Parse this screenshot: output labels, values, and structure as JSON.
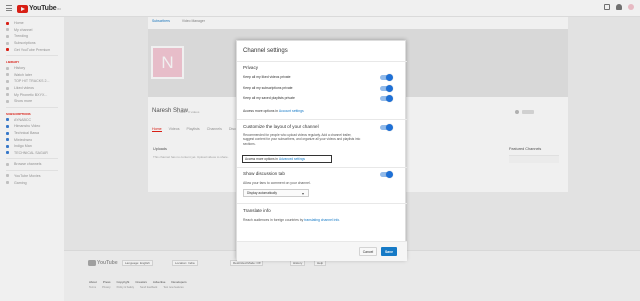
{
  "masthead": {
    "logo_text": "YouTube",
    "country_code": "IN",
    "icons": [
      "hamburger-icon",
      "upload-icon",
      "bell-icon",
      "avatar"
    ]
  },
  "sidebar": {
    "items_top": [
      {
        "label": "Home",
        "icon": "home-icon"
      },
      {
        "label": "My channel",
        "icon": "channel-icon"
      },
      {
        "label": "Trending",
        "icon": "trending-icon"
      },
      {
        "label": "Subscriptions",
        "icon": "subscriptions-icon"
      },
      {
        "label": "Get YouTube Premium",
        "icon": "premium-icon"
      }
    ],
    "library_head": "LIBRARY",
    "items_library": [
      {
        "label": "History",
        "icon": "history-icon"
      },
      {
        "label": "Watch later",
        "icon": "clock-icon"
      },
      {
        "label": "TOP HIT TRACKS 2...",
        "icon": "playlist-icon"
      },
      {
        "label": "Liked videos",
        "icon": "like-icon"
      },
      {
        "label": "My Phonetic BXYX...",
        "icon": "playlist-icon"
      },
      {
        "label": "Show more",
        "icon": "chevron-down-icon"
      }
    ],
    "subs_head": "SUBSCRIPTIONS",
    "items_subs": [
      {
        "label": "AYNABCC",
        "icon": "channel-avatar"
      },
      {
        "label": "Himanshu Video",
        "icon": "channel-avatar"
      },
      {
        "label": "Technical Bawa",
        "icon": "channel-avatar"
      },
      {
        "label": "Mixtechseo",
        "icon": "channel-avatar"
      },
      {
        "label": "Indigo Man",
        "icon": "channel-avatar"
      },
      {
        "label": "TECHNICAL SAGAR",
        "icon": "channel-avatar"
      }
    ],
    "items_bottom": [
      {
        "label": "Browse channels",
        "icon": "plus-icon"
      },
      {
        "label": "YouTube Movies",
        "icon": "movie-icon"
      },
      {
        "label": "Gaming",
        "icon": "gaming-icon"
      }
    ]
  },
  "channel": {
    "top_tabs": [
      "Subscribers",
      "Video Manager"
    ],
    "avatar_letter": "N",
    "name": "Naresh Shaw",
    "views": "1 view · 0 videos",
    "nav": [
      "Home",
      "Videos",
      "Playlists",
      "Channels",
      "Discussion",
      "About"
    ],
    "uploads": "Uploads",
    "uploads_sub": "This channel has no content yet. Upload videos to share.",
    "featured": "Featured Channels"
  },
  "footer": {
    "logo_text": "YouTube",
    "language_btn": "Language: English",
    "location_btn": "Location: India",
    "restricted_btn": "Restricted Mode: Off",
    "history_btn": "History",
    "help_btn": "Help",
    "links": [
      "About",
      "Press",
      "Copyright",
      "Creators",
      "Advertise",
      "Developers"
    ],
    "links2": [
      "Terms",
      "Privacy",
      "Policy & Safety",
      "Send feedback",
      "Test new features"
    ]
  },
  "modal": {
    "title": "Channel settings",
    "privacy": {
      "title": "Privacy",
      "rows": [
        "Keep all my liked videos private",
        "Keep all my subscriptions private",
        "Keep all my saved playlists private"
      ],
      "link_prefix": "Access more options in",
      "link_text": "Account settings"
    },
    "customize": {
      "title": "Customize the layout of your channel",
      "description": "Recommended for people who upload videos regularly. Add a channel trailer, suggest content for your subscribers, and organize all your videos and playlists into sections.",
      "link_prefix": "Access more options in",
      "link_text": "Advanced settings"
    },
    "discussion": {
      "title": "Show discussion tab",
      "description": "Allow your fans to comment on your channel.",
      "select_value": "Display automatically"
    },
    "translate": {
      "title": "Translate info",
      "prefix": "Reach audiences in foreign countries by",
      "link_text": "translating channel info."
    },
    "cancel_label": "Cancel",
    "save_label": "Save"
  },
  "colors": {
    "accent_blue": "#167ac6",
    "toggle_on": "#1e70d6",
    "brand_red": "#e62117"
  }
}
